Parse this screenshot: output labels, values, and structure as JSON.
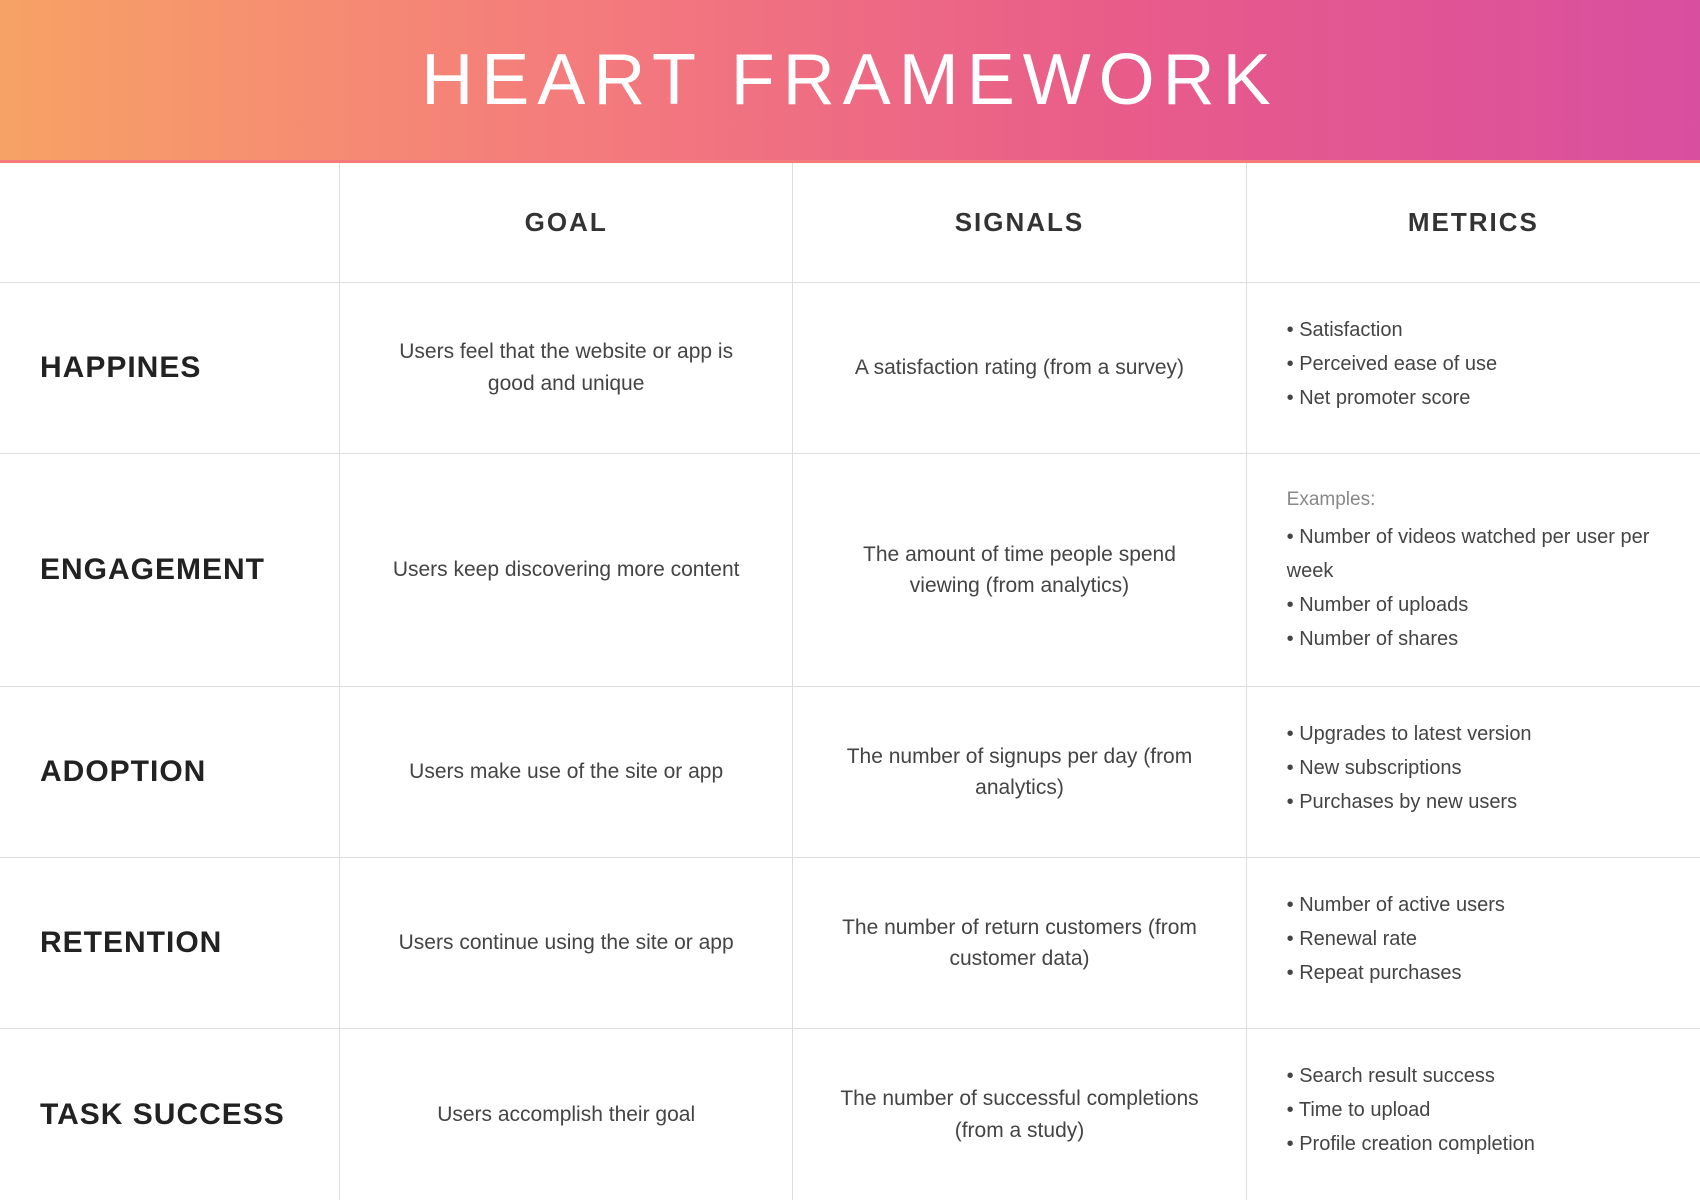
{
  "header": {
    "title": "HEART FRAMEWORK"
  },
  "columns": {
    "empty": "",
    "goal": "GOAL",
    "signals": "SIGNALS",
    "metrics": "METRICS"
  },
  "rows": [
    {
      "label": "HAPPINES",
      "goal": "Users feel that the website or app is good and unique",
      "signal": "A satisfaction rating (from a survey)",
      "metrics_note": "",
      "metrics": [
        "• Satisfaction",
        "• Perceived ease of use",
        "• Net promoter score"
      ]
    },
    {
      "label": "ENGAGEMENT",
      "goal": "Users keep discovering more content",
      "signal": "The amount of time people spend viewing (from analytics)",
      "metrics_note": "Examples:",
      "metrics": [
        "• Number of videos watched per user per week",
        "• Number of uploads",
        "• Number of shares"
      ]
    },
    {
      "label": "ADOPTION",
      "goal": "Users make use of the site or app",
      "signal": "The number of signups per day (from analytics)",
      "metrics_note": "",
      "metrics": [
        "• Upgrades to latest version",
        "• New subscriptions",
        "• Purchases by new users"
      ]
    },
    {
      "label": "RETENTION",
      "goal": "Users continue using the site or app",
      "signal": "The number of return customers (from customer data)",
      "metrics_note": "",
      "metrics": [
        "• Number of active users",
        "• Renewal rate",
        "• Repeat purchases"
      ]
    },
    {
      "label": "TASK SUCCESS",
      "goal": "Users accomplish their goal",
      "signal": "The number of successful completions (from a study)",
      "metrics_note": "",
      "metrics": [
        "• Search result success",
        "• Time to upload",
        "• Profile creation completion"
      ]
    }
  ]
}
